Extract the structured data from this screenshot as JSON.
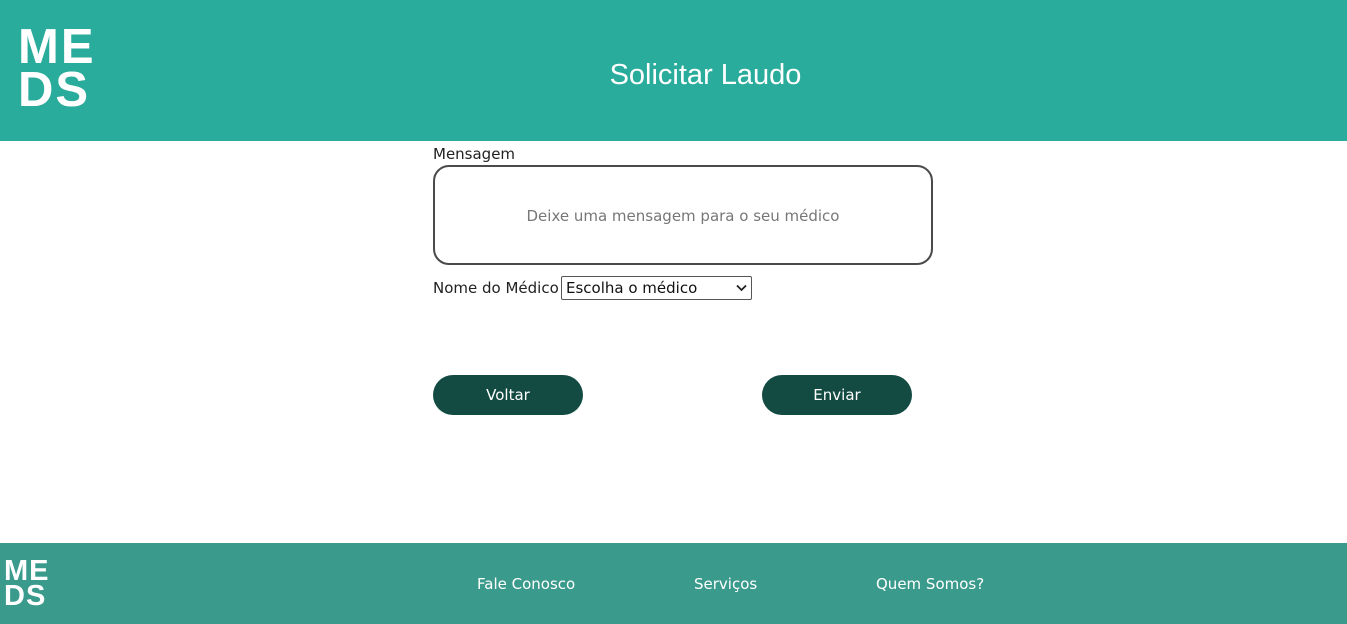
{
  "header": {
    "logo_line1": "ME",
    "logo_line2": "DS",
    "title": "Solicitar Laudo"
  },
  "form": {
    "message_label": "Mensagem",
    "message_placeholder": "Deixe uma mensagem para o seu médico",
    "message_value": "",
    "doctor_label": "Nome do Médico",
    "doctor_selected": "Escolha o médico",
    "back_label": "Voltar",
    "submit_label": "Enviar"
  },
  "footer": {
    "logo_line1": "ME",
    "logo_line2": "DS",
    "links": [
      "Fale Conosco",
      "Serviços",
      "Quem Somos?"
    ]
  },
  "colors": {
    "header_bg": "#2aac9c",
    "footer_bg": "#3a9a8c",
    "button_bg": "#134a42"
  }
}
